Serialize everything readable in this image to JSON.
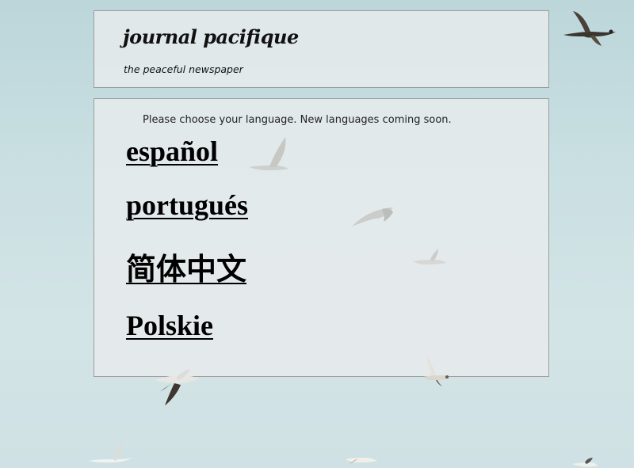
{
  "header": {
    "title": "journal pacifique",
    "tagline": "the peaceful newspaper"
  },
  "content": {
    "intro": "Please choose your language. New languages coming soon.",
    "languages": [
      {
        "label": "español"
      },
      {
        "label": "portugués"
      },
      {
        "label": "简体中文"
      },
      {
        "label": "Polskie"
      }
    ]
  },
  "background": {
    "description_icons": [
      "seagull-icon"
    ],
    "sky_color": "#c9dfe2",
    "panel_border_color": "#9a9f9c"
  }
}
